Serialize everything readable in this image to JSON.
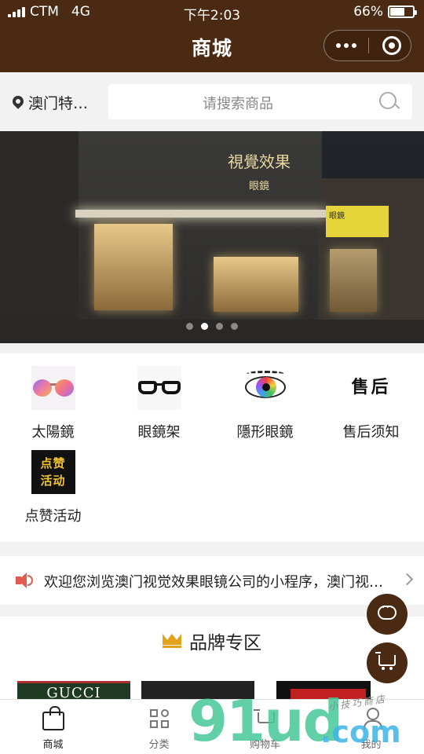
{
  "status_bar": {
    "carrier": "CTM",
    "network": "4G",
    "time": "下午2:03",
    "battery": "66%",
    "battery_level": 0.66
  },
  "header": {
    "title": "商城"
  },
  "location": {
    "label": "澳门特…"
  },
  "search": {
    "placeholder": "请搜索商品"
  },
  "banner": {
    "slide_count": 4,
    "active_slide": 2,
    "shop_sign": "視覺效果",
    "shop_sign_sub": "眼鏡",
    "yellow_sign": "眼鏡"
  },
  "categories": [
    {
      "label": "太陽鏡",
      "icon": "sunglasses-icon"
    },
    {
      "label": "眼鏡架",
      "icon": "eyeglass-frames-icon"
    },
    {
      "label": "隱形眼鏡",
      "icon": "contact-lens-eye-icon"
    },
    {
      "label": "售后须知",
      "icon": "after-sales-icon",
      "icon_text": "售后"
    },
    {
      "label": "点赞活动",
      "icon": "likes-activity-icon",
      "icon_text_1": "点赞",
      "icon_text_2": "活动"
    }
  ],
  "notice": {
    "text": "欢迎您浏览澳门视觉效果眼镜公司的小程序，澳门视觉效果眼镜公司"
  },
  "brand_section": {
    "title": "品牌专区",
    "brands": [
      "GUCCI"
    ]
  },
  "tabbar": [
    {
      "label": "商城",
      "active": true
    },
    {
      "label": "分类",
      "active": false
    },
    {
      "label": "购物车",
      "active": false
    },
    {
      "label": "我的",
      "active": false
    }
  ],
  "watermark": {
    "main": "91ud",
    "domain": ".com",
    "tagline": "小技巧商店"
  },
  "colors": {
    "brand_brown": "#4a2a12",
    "notice_red": "#e35a4f",
    "crown_gold": "#e3a21c"
  }
}
